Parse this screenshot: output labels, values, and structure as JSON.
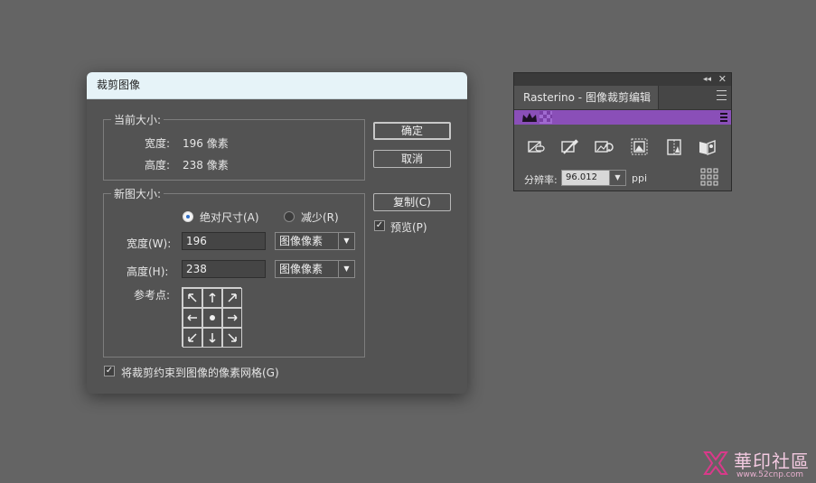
{
  "dialog": {
    "title": "裁剪图像",
    "current_size": {
      "legend": "当前大小:",
      "width_label": "宽度:",
      "width_value": "196 像素",
      "height_label": "高度:",
      "height_value": "238 像素"
    },
    "new_size": {
      "legend": "新图大小:",
      "mode_absolute": "绝对尺寸(A)",
      "mode_reduce": "减少(R)",
      "mode_selected": "absolute",
      "width_label": "宽度(W):",
      "width_value": "196",
      "width_unit": "图像像素",
      "height_label": "高度(H):",
      "height_value": "238",
      "height_unit": "图像像素",
      "anchor_label": "参考点:"
    },
    "buttons": {
      "ok": "确定",
      "cancel": "取消",
      "copy": "复制(C)"
    },
    "preview_label": "预览(P)",
    "preview_checked": true,
    "constrain_label": "将裁剪约束到图像的像素网格(G)",
    "constrain_checked": true
  },
  "panel": {
    "tab_title": "Rasterino - 图像裁剪编辑",
    "resolution_label": "分辨率:",
    "resolution_value": "96.012",
    "resolution_unit": "ppi",
    "accent_color": "#8a4fb8",
    "tools": [
      "link-crop-icon",
      "brush-crop-icon",
      "rotate-crop-icon",
      "frame-crop-icon",
      "split-image-icon",
      "puzzle-icon"
    ]
  },
  "watermark": {
    "text": "華印社區",
    "url": "www.52cnp.com"
  }
}
